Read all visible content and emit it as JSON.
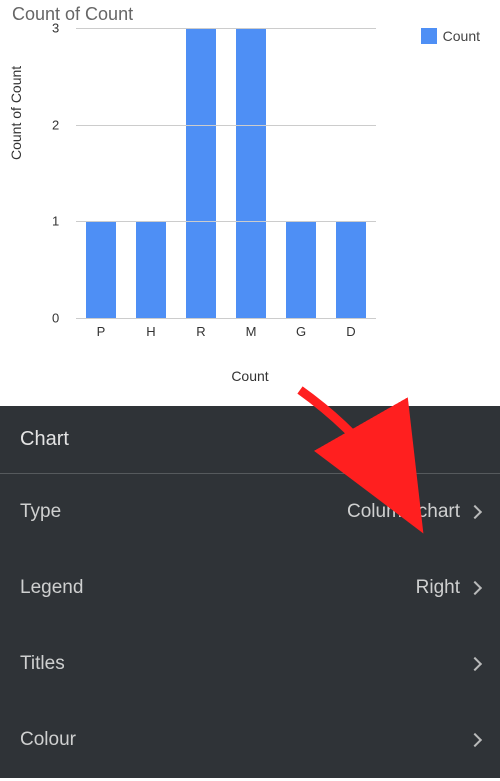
{
  "chart_data": {
    "type": "bar",
    "title": "Count of Count",
    "categories": [
      "P",
      "H",
      "R",
      "M",
      "G",
      "D"
    ],
    "values": [
      1,
      1,
      3,
      3,
      1,
      1
    ],
    "xlabel": "Count",
    "ylabel": "Count of Count",
    "ylim": [
      0,
      3
    ],
    "yticks": [
      0,
      1,
      2,
      3
    ],
    "series": [
      {
        "name": "Count",
        "values": [
          1,
          1,
          3,
          3,
          1,
          1
        ]
      }
    ],
    "legend_position": "Right",
    "bar_color": "#4e8ff5"
  },
  "legend": {
    "label": "Count"
  },
  "panel": {
    "header": "Chart",
    "rows": {
      "type": {
        "label": "Type",
        "value": "Column chart"
      },
      "legend": {
        "label": "Legend",
        "value": "Right"
      },
      "titles": {
        "label": "Titles",
        "value": ""
      },
      "colour": {
        "label": "Colour",
        "value": ""
      }
    }
  }
}
